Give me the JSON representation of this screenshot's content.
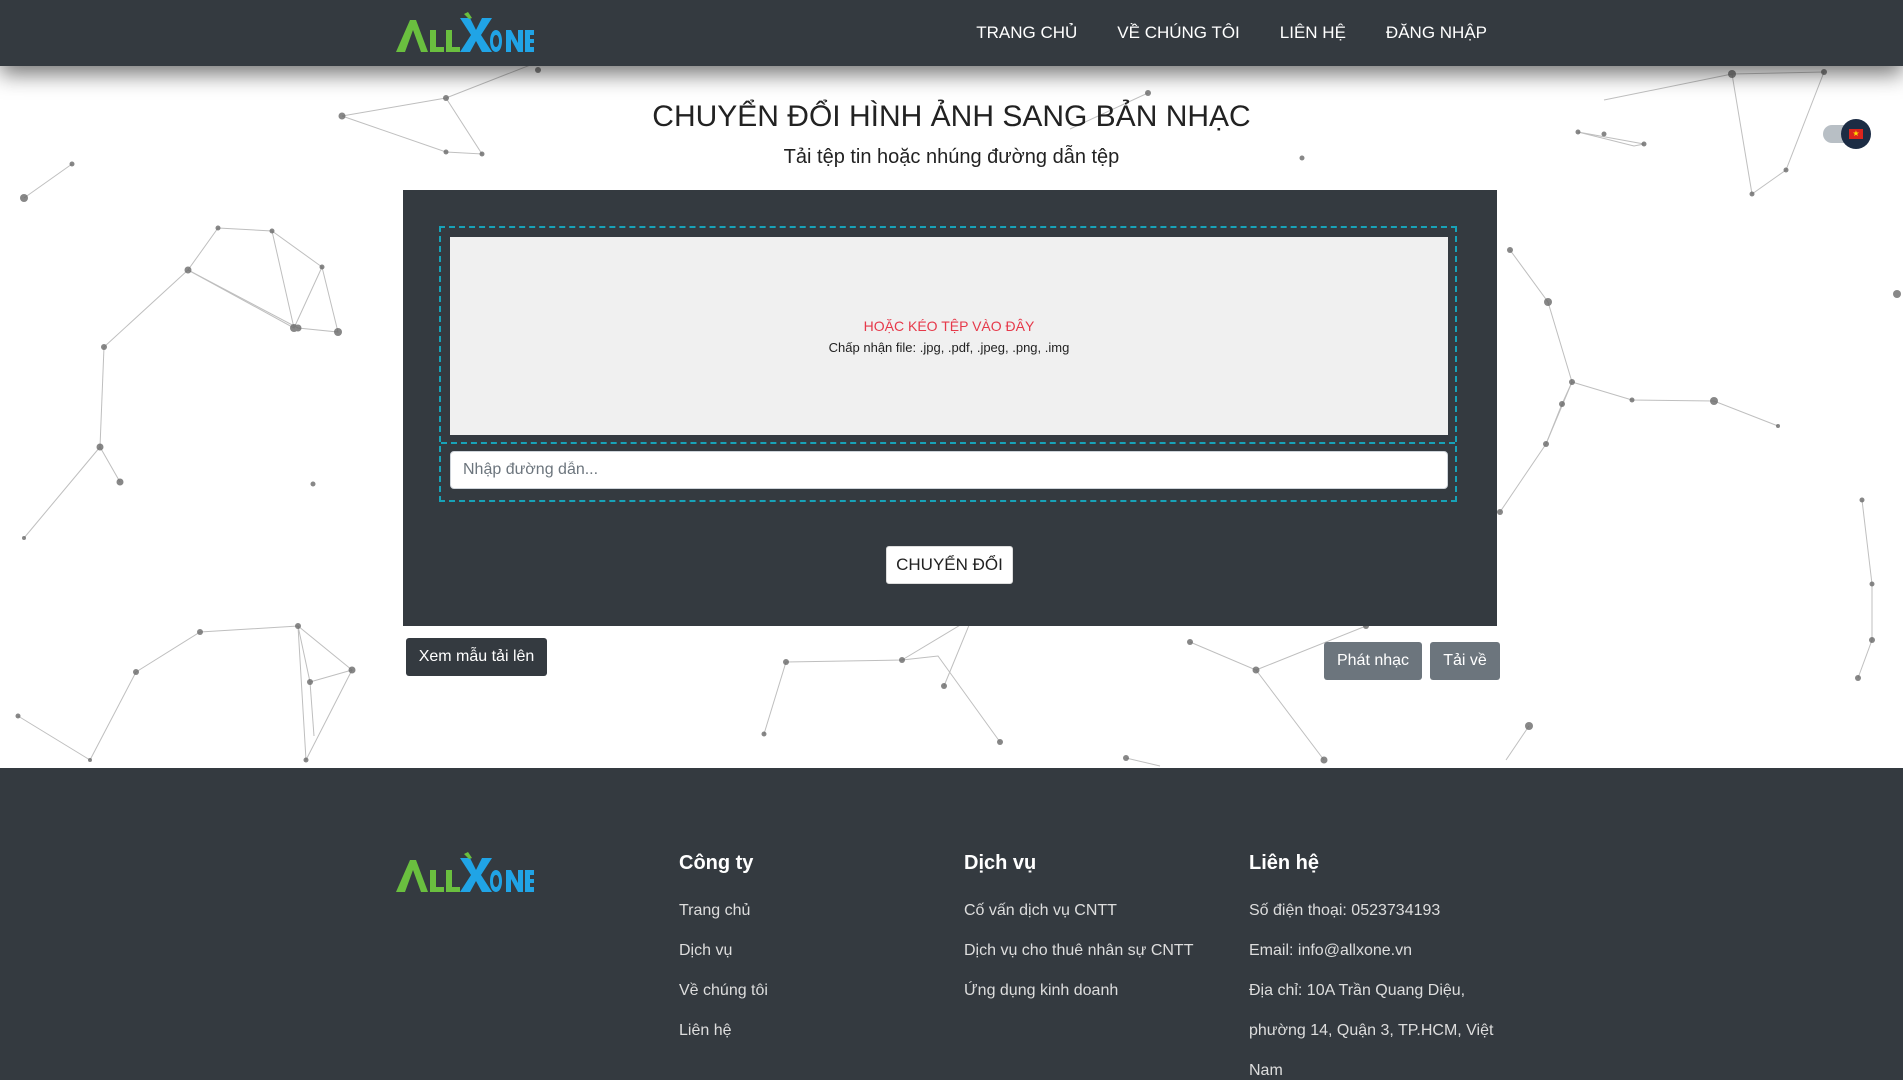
{
  "brand": {
    "logo_text": "ALLXONE",
    "colors": {
      "green": "#6abf3f",
      "blue": "#20a4e6",
      "accent": "#17a2b8",
      "danger": "#e6394a",
      "dark": "#343a40"
    }
  },
  "nav": {
    "items": [
      {
        "label": "TRANG CHỦ"
      },
      {
        "label": "VỀ CHÚNG TÔI"
      },
      {
        "label": "LIÊN HỆ"
      },
      {
        "label": "ĐĂNG NHẬP"
      }
    ]
  },
  "language": {
    "icon": "vietnam-flag-icon"
  },
  "hero": {
    "title": "CHUYỂN ĐỔI HÌNH ẢNH SANG BẢN NHẠC",
    "subtitle": "Tải tệp tin hoặc nhúng đường dẫn tệp"
  },
  "upload": {
    "drop_label": "HOẶC KÉO TỆP VÀO ĐÂY",
    "accept_label": "Chấp nhận file: .jpg, .pdf, .jpeg, .png, .img",
    "url_placeholder": "Nhập đường dẫn...",
    "url_value": "",
    "convert_label": "CHUYỂN ĐỔI"
  },
  "actions": {
    "sample_label": "Xem mẫu tải lên",
    "play_label": "Phát nhạc",
    "download_label": "Tải về"
  },
  "footer": {
    "company": {
      "heading": "Công ty",
      "items": [
        "Trang chủ",
        "Dịch vụ",
        "Về chúng tôi",
        "Liên hệ"
      ]
    },
    "services": {
      "heading": "Dịch vụ",
      "items": [
        "Cố vấn dịch vụ CNTT",
        "Dịch vụ cho thuê nhân sự CNTT",
        "Ứng dụng kinh doanh"
      ]
    },
    "contact": {
      "heading": "Liên hệ",
      "phone": "Số điện thoại: 0523734193",
      "email": "Email: info@allxone.vn",
      "address_line1": "Địa chỉ: 10A Trần Quang Diệu,",
      "address_line2": "phường 14, Quận 3, TP.HCM, Việt",
      "address_line3": "Nam"
    }
  }
}
